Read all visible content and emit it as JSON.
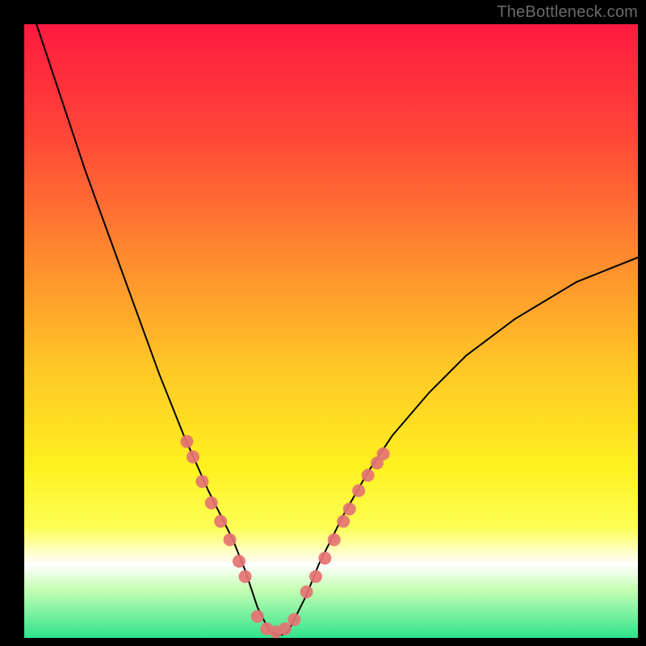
{
  "watermark": "TheBottleneck.com",
  "chart_data": {
    "type": "line",
    "title": "",
    "xlabel": "",
    "ylabel": "",
    "xlim": [
      0,
      100
    ],
    "ylim": [
      0,
      100
    ],
    "legend": false,
    "grid": false,
    "background_gradient": {
      "stops": [
        {
          "offset": 0.0,
          "color": "#ff1a3f"
        },
        {
          "offset": 0.18,
          "color": "#ff4638"
        },
        {
          "offset": 0.38,
          "color": "#ff8a2f"
        },
        {
          "offset": 0.56,
          "color": "#ffc727"
        },
        {
          "offset": 0.72,
          "color": "#fff11f"
        },
        {
          "offset": 0.82,
          "color": "#fdff55"
        },
        {
          "offset": 0.88,
          "color": "#ffffff"
        },
        {
          "offset": 0.92,
          "color": "#c8ffb5"
        },
        {
          "offset": 1.0,
          "color": "#2fe38b"
        }
      ]
    },
    "series": [
      {
        "name": "bottleneck-curve",
        "type": "line",
        "color": "#000000",
        "width": 2,
        "x": [
          2,
          6,
          10,
          14,
          18,
          22,
          26,
          30,
          32,
          34,
          36,
          37,
          38,
          39,
          40,
          41,
          42,
          43,
          44,
          46,
          48,
          52,
          56,
          60,
          66,
          72,
          80,
          90,
          100
        ],
        "y": [
          100,
          88,
          76,
          65,
          54,
          43,
          33,
          24,
          20,
          16,
          11,
          8,
          5,
          3,
          1,
          0.5,
          0.5,
          1,
          3,
          7,
          12,
          20,
          27,
          33,
          40,
          46,
          52,
          58,
          62
        ]
      },
      {
        "name": "left-cluster-markers",
        "type": "scatter",
        "color": "#e57373",
        "radius": 8,
        "x": [
          26.5,
          27.5,
          29.0,
          30.5,
          32.0,
          33.5,
          35.0,
          36.0
        ],
        "y": [
          32.0,
          29.5,
          25.5,
          22.0,
          19.0,
          16.0,
          12.5,
          10.0
        ]
      },
      {
        "name": "valley-markers",
        "type": "scatter",
        "color": "#e57373",
        "radius": 8,
        "x": [
          38.0,
          39.5,
          41.0,
          42.5,
          44.0
        ],
        "y": [
          3.5,
          1.5,
          1.0,
          1.5,
          3.0
        ]
      },
      {
        "name": "right-cluster-markers",
        "type": "scatter",
        "color": "#e57373",
        "radius": 8,
        "x": [
          46.0,
          47.5,
          49.0,
          50.5,
          52.0,
          53.0,
          54.5,
          56.0,
          57.5,
          58.5
        ],
        "y": [
          7.5,
          10.0,
          13.0,
          16.0,
          19.0,
          21.0,
          24.0,
          26.5,
          28.5,
          30.0
        ]
      }
    ]
  }
}
